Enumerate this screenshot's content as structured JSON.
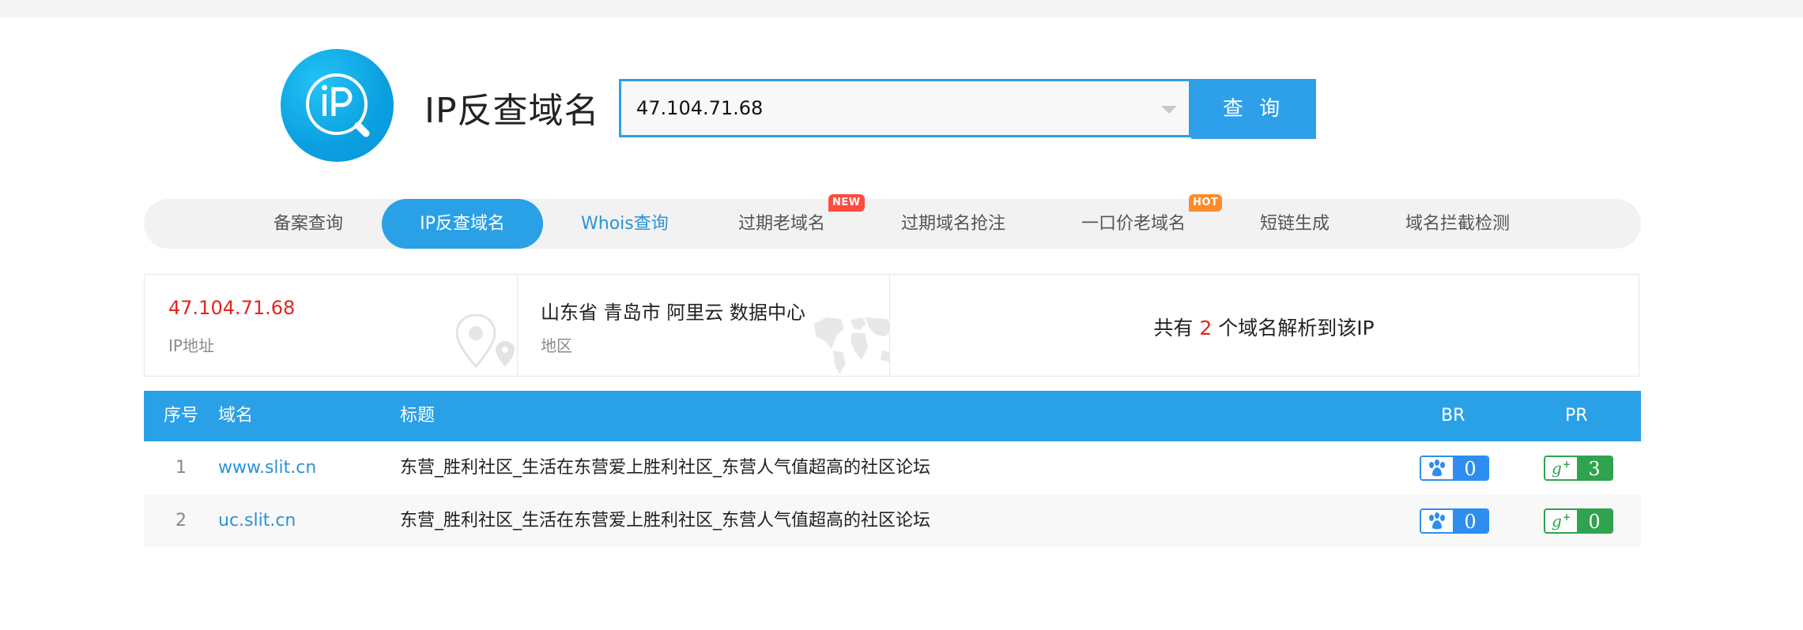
{
  "header": {
    "app_title": "IP反查域名",
    "logo_icon": "ip-search-logo-icon"
  },
  "search": {
    "value": "47.104.71.68",
    "button_label": "查 询"
  },
  "nav": {
    "items": [
      {
        "label": "备案查询"
      },
      {
        "label": "IP反查域名"
      },
      {
        "label": "Whois查询"
      },
      {
        "label": "过期老域名",
        "badge": "NEW"
      },
      {
        "label": "过期域名抢注"
      },
      {
        "label": "一口价老域名",
        "badge": "HOT"
      },
      {
        "label": "短链生成"
      },
      {
        "label": "域名拦截检测"
      }
    ]
  },
  "info": {
    "ip": "47.104.71.68",
    "ip_label": "IP地址",
    "region": "山东省 青岛市 阿里云 数据中心",
    "region_label": "地区",
    "count_prefix": "共有",
    "count": "2",
    "count_suffix": "个域名解析到该IP"
  },
  "table": {
    "columns": [
      "序号",
      "域名",
      "标题",
      "BR",
      "PR"
    ],
    "rows": [
      {
        "index": "1",
        "domain": "www.slit.cn",
        "title": "东营_胜利社区_生活在东营爱上胜利社区_东营人气值超高的社区论坛",
        "br": "0",
        "pr": "3"
      },
      {
        "index": "2",
        "domain": "uc.slit.cn",
        "title": "东营_胜利社区_生活在东营爱上胜利社区_东营人气值超高的社区论坛",
        "br": "0",
        "pr": "0"
      }
    ]
  },
  "colors": {
    "accent": "#2aa0e7",
    "highlight_red": "#e8231f",
    "br_blue": "#2d8ef0",
    "pr_green": "#2fa34d"
  }
}
